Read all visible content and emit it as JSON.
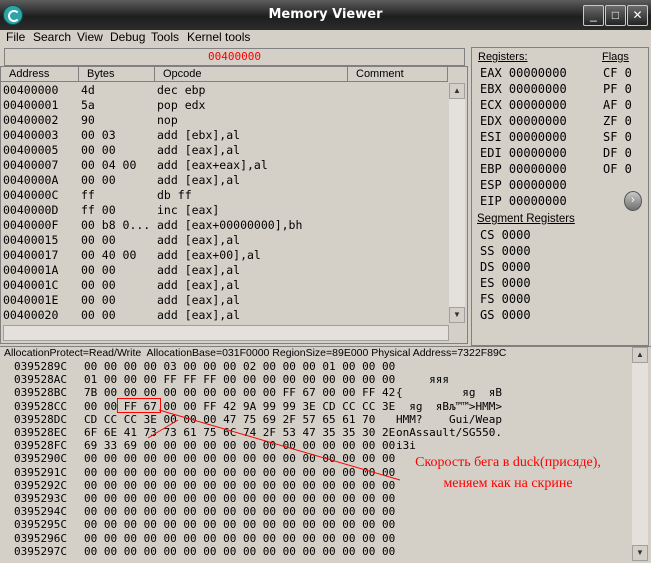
{
  "window": {
    "title": "Memory Viewer",
    "buttons": [
      "_",
      "□",
      "✕"
    ]
  },
  "menu": [
    "File",
    "Search",
    "View",
    "Debug",
    "Tools",
    "Kernel tools"
  ],
  "address_bar": "00400000",
  "disassembler": {
    "columns": [
      "Address",
      "Bytes",
      "Opcode",
      "Comment"
    ],
    "rows": [
      {
        "addr": "00400000",
        "bytes": "4d",
        "op": "dec ebp"
      },
      {
        "addr": "00400001",
        "bytes": "5a",
        "op": "pop edx"
      },
      {
        "addr": "00400002",
        "bytes": "90",
        "op": "nop"
      },
      {
        "addr": "00400003",
        "bytes": "00 03",
        "op": "add [ebx],al"
      },
      {
        "addr": "00400005",
        "bytes": "00 00",
        "op": "add [eax],al"
      },
      {
        "addr": "00400007",
        "bytes": "00 04 00",
        "op": "add [eax+eax],al"
      },
      {
        "addr": "0040000A",
        "bytes": "00 00",
        "op": "add [eax],al"
      },
      {
        "addr": "0040000C",
        "bytes": "ff",
        "op": "db ff"
      },
      {
        "addr": "0040000D",
        "bytes": "ff 00",
        "op": "inc [eax]"
      },
      {
        "addr": "0040000F",
        "bytes": "00 b8 0...",
        "op": "add [eax+00000000],bh"
      },
      {
        "addr": "00400015",
        "bytes": "00 00",
        "op": "add [eax],al"
      },
      {
        "addr": "00400017",
        "bytes": "00 40 00",
        "op": "add [eax+00],al"
      },
      {
        "addr": "0040001A",
        "bytes": "00 00",
        "op": "add [eax],al"
      },
      {
        "addr": "0040001C",
        "bytes": "00 00",
        "op": "add [eax],al"
      },
      {
        "addr": "0040001E",
        "bytes": "00 00",
        "op": "add [eax],al"
      },
      {
        "addr": "00400020",
        "bytes": "00 00",
        "op": "add [eax],al"
      }
    ]
  },
  "registers": {
    "header": "Registers:",
    "items": [
      "EAX 00000000",
      "EBX 00000000",
      "ECX 00000000",
      "EDX 00000000",
      "ESI 00000000",
      "EDI 00000000",
      "EBP 00000000",
      "ESP 00000000",
      "EIP 00000000"
    ],
    "more_button": "›"
  },
  "flags": {
    "header": "Flags",
    "items": [
      "CF 0",
      "PF 0",
      "AF 0",
      "ZF 0",
      "SF 0",
      "DF 0",
      "OF 0"
    ]
  },
  "segment_registers": {
    "header": "Segment Registers",
    "items": [
      "CS 0000",
      "SS 0000",
      "DS 0000",
      "ES 0000",
      "FS 0000",
      "GS 0000"
    ]
  },
  "hex_view": {
    "info": "AllocationProtect=Read/Write  AllocationBase=031F0000 RegionSize=89E000 Physical Address=7322F89C",
    "rows": [
      {
        "addr": "0395289C",
        "hex": "00 00 00 00 03 00 00 00 02 00 00 00 01 00 00 00",
        "ascii": ""
      },
      {
        "addr": "039528AC",
        "hex": "01 00 00 00 FF FF FF 00 00 00 00 00 00 00 00 00",
        "ascii": "     яяя"
      },
      {
        "addr": "039528BC",
        "hex": "7B 00 00 00 00 00 00 00 00 00 FF 67 00 00 FF 42",
        "ascii": "{         яg  яB"
      },
      {
        "addr": "039528CC",
        "hex": "00 00 FF 67 00 00 FF 42 9A 99 99 3E CD CC CC 3E",
        "ascii": "  яg  яBљ™™>НММ>"
      },
      {
        "addr": "039528DC",
        "hex": "CD CC CC 3E 00 00 00 47 75 69 2F 57 65 61 70",
        "ascii": "НММ?    Gui/Weap"
      },
      {
        "addr": "039528EC",
        "hex": "6F 6E 41 73 73 61 75 6C 74 2F 53 47 35 35 30 2E",
        "ascii": "onAssault/SG550."
      },
      {
        "addr": "039528FC",
        "hex": "69 33 69 00 00 00 00 00 00 00 00 00 00 00 00 00",
        "ascii": "i3i"
      },
      {
        "addr": "0395290C",
        "hex": "00 00 00 00 00 00 00 00 00 00 00 00 00 00 00 00",
        "ascii": ""
      },
      {
        "addr": "0395291C",
        "hex": "00 00 00 00 00 00 00 00 00 00 00 00 00 00 00 00",
        "ascii": ""
      },
      {
        "addr": "0395292C",
        "hex": "00 00 00 00 00 00 00 00 00 00 00 00 00 00 00 00",
        "ascii": ""
      },
      {
        "addr": "0395293C",
        "hex": "00 00 00 00 00 00 00 00 00 00 00 00 00 00 00 00",
        "ascii": ""
      },
      {
        "addr": "0395294C",
        "hex": "00 00 00 00 00 00 00 00 00 00 00 00 00 00 00 00",
        "ascii": ""
      },
      {
        "addr": "0395295C",
        "hex": "00 00 00 00 00 00 00 00 00 00 00 00 00 00 00 00",
        "ascii": ""
      },
      {
        "addr": "0395296C",
        "hex": "00 00 00 00 00 00 00 00 00 00 00 00 00 00 00 00",
        "ascii": ""
      },
      {
        "addr": "0395297C",
        "hex": "00 00 00 00 00 00 00 00 00 00 00 00 00 00 00 00",
        "ascii": ""
      }
    ]
  },
  "annotation": {
    "text": "Скорость бега в duck(присяде), меняем как на скрине",
    "color": "#ff0000"
  }
}
